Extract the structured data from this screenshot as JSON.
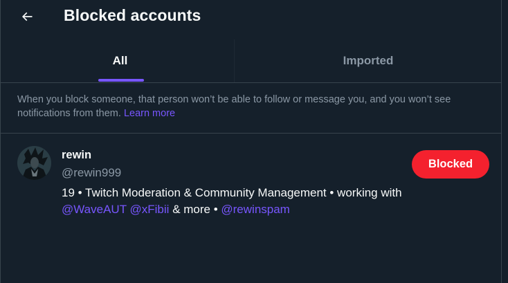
{
  "header": {
    "title": "Blocked accounts",
    "back_icon": "arrow-left-icon"
  },
  "tabs": [
    {
      "label": "All",
      "selected": true
    },
    {
      "label": "Imported",
      "selected": false
    }
  ],
  "notice": {
    "text": "When you block someone, that person won’t be able to follow or message you, and you won’t see notifications from them.",
    "link": "Learn more"
  },
  "blocked_users": [
    {
      "name": "rewin",
      "handle": "@rewin999",
      "bio_text_1": "19 • Twitch Moderation & Community Management • working with",
      "bio_mention_1": "@WaveAUT",
      "bio_mention_2": "@xFibii",
      "bio_text_2": "& more •",
      "bio_mention_3": "@rewinspam",
      "button_label": "Blocked"
    }
  ],
  "colors": {
    "background": "#15202b",
    "accent": "#7856ff",
    "danger": "#f4212e",
    "muted_text": "#8b98a5",
    "border": "#38444d"
  }
}
